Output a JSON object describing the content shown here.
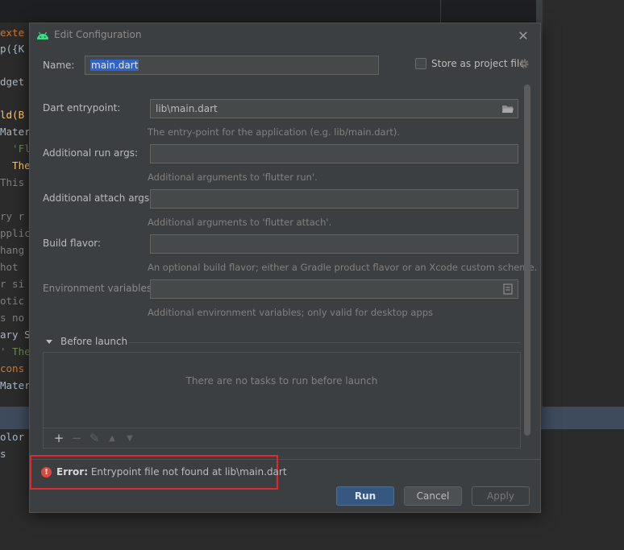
{
  "editor": {
    "code_fragments": [
      {
        "text": "exte",
        "color": "#cc7832"
      },
      {
        "text": "p({K",
        "color": "#a9b7c6"
      },
      {
        "text": "dget",
        "color": "#a9b7c6"
      },
      {
        "text": "ld(B",
        "color": "#ffc66d"
      },
      {
        "text": "Mater",
        "color": "#a9b7c6"
      },
      {
        "text": "  'Fl",
        "color": "#6a8759"
      },
      {
        "text": "  Ther",
        "color": "#ffc66d"
      },
      {
        "text": "This ",
        "color": "#808080"
      },
      {
        "text": "ry r",
        "color": "#808080"
      },
      {
        "text": "pplic",
        "color": "#808080"
      },
      {
        "text": "hang",
        "color": "#808080"
      },
      {
        "text": "hot ",
        "color": "#808080"
      },
      {
        "text": "r si",
        "color": "#808080"
      },
      {
        "text": "otic",
        "color": "#808080"
      },
      {
        "text": "s no",
        "color": "#808080"
      },
      {
        "text": "ary S",
        "color": "#a9b7c6"
      },
      {
        "text": "' Ther",
        "color": "#6a8759"
      },
      {
        "text": "cons",
        "color": "#cc7832"
      },
      {
        "text": "Mater",
        "color": "#a9b7c6"
      },
      {
        "text": "olor",
        "color": "#a9b7c6"
      },
      {
        "text": "s",
        "color": "#a9b7c6"
      }
    ]
  },
  "dialog": {
    "title": "Edit Configuration",
    "close_glyph": "✕",
    "name_label": "Name:",
    "name_value": "main.dart",
    "store_label": "Store as project file",
    "fields": {
      "dart_entrypoint": {
        "label": "Dart entrypoint:",
        "value": "lib\\main.dart",
        "hint": "The entry-point for the application (e.g. lib/main.dart)."
      },
      "additional_run_args": {
        "label": "Additional run args:",
        "value": "",
        "hint": "Additional arguments to 'flutter run'."
      },
      "additional_attach_args": {
        "label": "Additional attach args:",
        "value": "",
        "hint": "Additional arguments to 'flutter attach'."
      },
      "build_flavor": {
        "label": "Build flavor:",
        "value": "",
        "hint": "An optional build flavor; either a Gradle product flavor or an Xcode custom scheme."
      },
      "environment_variables": {
        "label": "Environment variables:",
        "value": "",
        "hint": "Additional environment variables; only valid for desktop apps"
      }
    },
    "before_launch": {
      "title": "Before launch",
      "empty_text": "There are no tasks to run before launch",
      "toolbar": {
        "add": "+",
        "remove": "−",
        "edit": "✎",
        "up": "▲",
        "down": "▼"
      }
    },
    "error": {
      "icon": "!",
      "prefix": "Error:",
      "message": "Entrypoint file not found at lib\\main.dart"
    },
    "buttons": {
      "run": "Run",
      "cancel": "Cancel",
      "apply": "Apply"
    },
    "colors": {
      "accent": "#365880",
      "error": "#e5282c",
      "android": "#3ddc84"
    }
  }
}
